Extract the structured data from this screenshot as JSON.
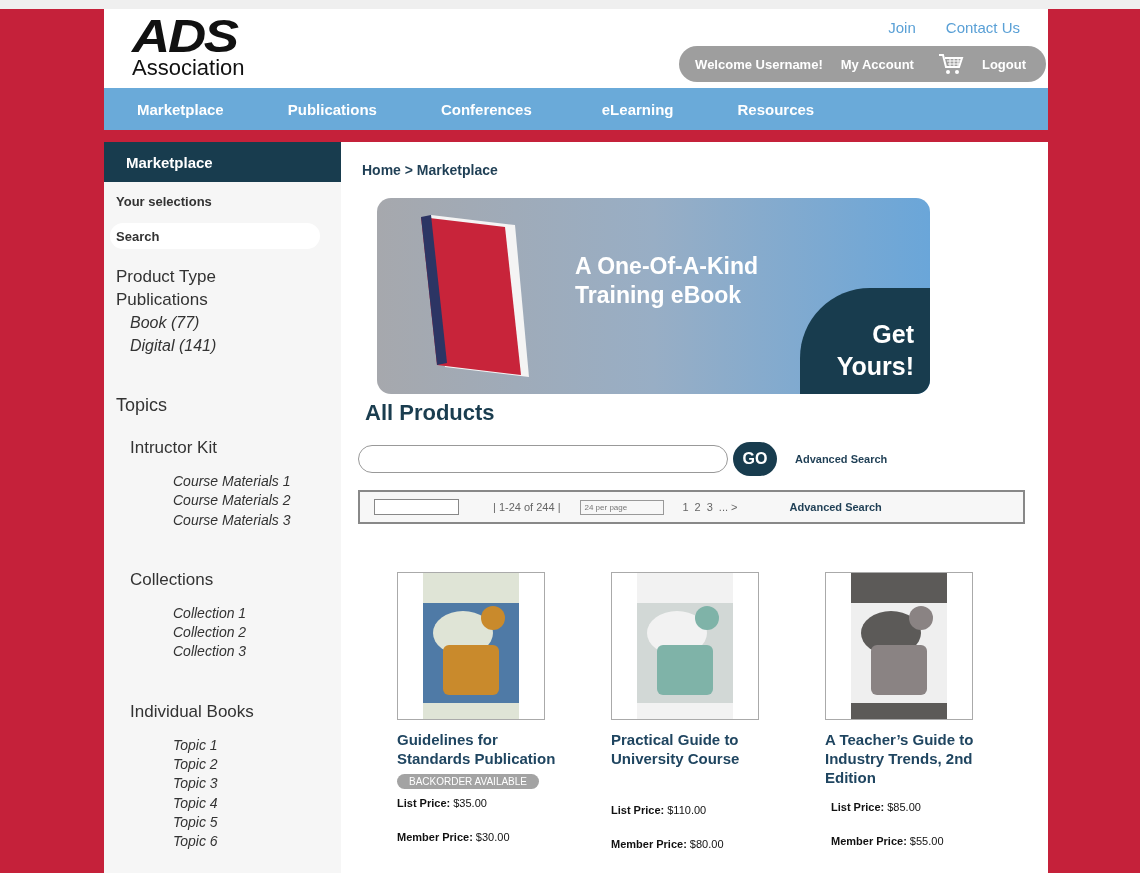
{
  "header": {
    "logo": {
      "mark": "ADS",
      "name": "Association"
    },
    "top_links": [
      "Join",
      "Contact Us"
    ],
    "user_bar": {
      "welcome": "Welcome Username!",
      "my_account": "My Account",
      "logout": "Logout"
    }
  },
  "nav": {
    "items": [
      "Marketplace",
      "Publications",
      "Conferences",
      "eLearning",
      "Resources"
    ]
  },
  "sidebar": {
    "title": "Marketplace",
    "your_selections": "Your selections",
    "search": {
      "placeholder": "Search"
    },
    "product_type": {
      "heading": "Product Type",
      "subheading": "Publications",
      "items": [
        "Book (77)",
        "Digital (141)"
      ]
    },
    "topics": {
      "heading": "Topics",
      "groups": [
        {
          "title": "Intructor Kit",
          "items": [
            "Course Materials 1",
            "Course Materials 2",
            "Course Materials 3"
          ]
        },
        {
          "title": "Collections",
          "items": [
            "Collection 1",
            "Collection 2",
            "Collection 3"
          ]
        },
        {
          "title": "Individual Books",
          "items": [
            "Topic 1",
            "Topic 2",
            "Topic 3",
            "Topic 4",
            "Topic 5",
            "Topic 6"
          ]
        }
      ]
    }
  },
  "main": {
    "breadcrumb": "Home > Marketplace",
    "banner": {
      "headline": "A One-Of-A-Kind Training eBook",
      "cta": "Get Yours!"
    },
    "section_title": "All Products",
    "search": {
      "button": "GO",
      "advanced": "Advanced Search"
    },
    "pager": {
      "range": "| 1-24 of 244 |",
      "per_page": "24 per page",
      "pages": [
        "1",
        "2",
        "3"
      ],
      "next": "... >",
      "advanced": "Advanced Search"
    },
    "products": [
      {
        "title": "Guidelines for Standards Publication",
        "badge": "BACKORDER AVAILABLE",
        "list_price": "**List Price:** $35.00",
        "member_price": "**Member Price:** $30.00"
      },
      {
        "title": "Practical Guide to University Course",
        "list_price": "**List Price:** $110.00",
        "member_price": "**Member Price:** $80.00"
      },
      {
        "title": "A Teacher’s Guide to Industry Trends, 2nd Edition",
        "list_price": "**List Price:** $85.00",
        "member_price": "**Member Price:** $55.00"
      }
    ]
  }
}
